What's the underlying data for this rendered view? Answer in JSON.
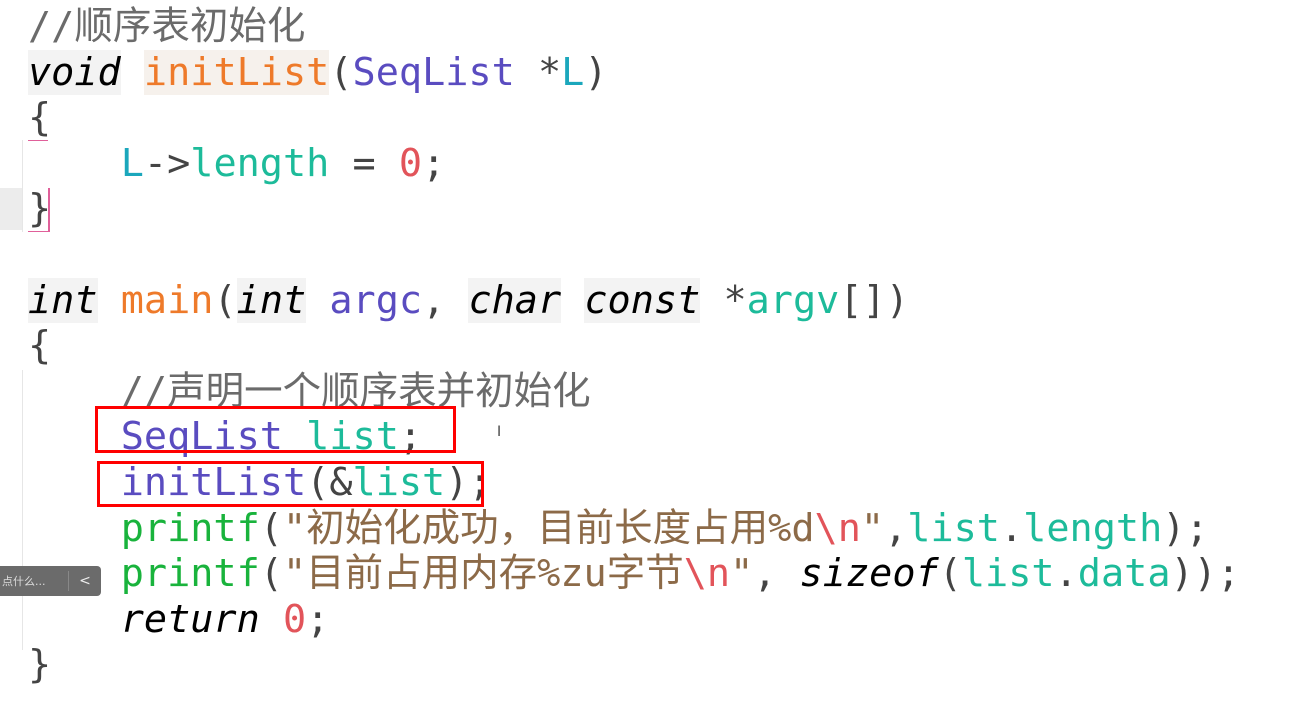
{
  "code_lines": [
    [
      [
        "comment",
        "//顺序表初始化"
      ]
    ],
    [
      [
        "kw",
        "void"
      ],
      [
        "punct",
        " "
      ],
      [
        "fn",
        "initList"
      ],
      [
        "punct",
        "("
      ],
      [
        "type",
        "SeqList"
      ],
      [
        "punct",
        " *"
      ],
      [
        "param",
        "L"
      ],
      [
        "punct",
        ")"
      ]
    ],
    [
      [
        "punct",
        "{"
      ]
    ],
    [
      [
        "punct",
        "    "
      ],
      [
        "param",
        "L"
      ],
      [
        "punct",
        "->"
      ],
      [
        "member",
        "length"
      ],
      [
        "punct",
        " = "
      ],
      [
        "num",
        "0"
      ],
      [
        "punct",
        ";"
      ]
    ],
    [
      [
        "punct",
        "}"
      ]
    ],
    [],
    [
      [
        "kw",
        "int"
      ],
      [
        "punct",
        " "
      ],
      [
        "fnm",
        "main"
      ],
      [
        "punct",
        "("
      ],
      [
        "kw",
        "int"
      ],
      [
        "punct",
        " "
      ],
      [
        "type",
        "argc"
      ],
      [
        "punct",
        ", "
      ],
      [
        "kw",
        "char"
      ],
      [
        "punct",
        " "
      ],
      [
        "kw",
        "const"
      ],
      [
        "punct",
        " *"
      ],
      [
        "member",
        "argv"
      ],
      [
        "punct",
        "[])"
      ]
    ],
    [
      [
        "punct",
        "{"
      ]
    ],
    [
      [
        "punct",
        "    "
      ],
      [
        "comment",
        "//声明一个顺序表并初始化"
      ]
    ],
    [
      [
        "punct",
        "    "
      ],
      [
        "type",
        "SeqList"
      ],
      [
        "punct",
        " "
      ],
      [
        "member",
        "list"
      ],
      [
        "punct",
        ";"
      ]
    ],
    [
      [
        "punct",
        "    "
      ],
      [
        "call2",
        "initList"
      ],
      [
        "punct",
        "(&"
      ],
      [
        "member",
        "list"
      ],
      [
        "punct",
        ");"
      ]
    ],
    [
      [
        "punct",
        "    "
      ],
      [
        "call",
        "printf"
      ],
      [
        "punct",
        "("
      ],
      [
        "str",
        "\"初始化成功，目前长度占用%d"
      ],
      [
        "esc",
        "\\n"
      ],
      [
        "str",
        "\""
      ],
      [
        "punct",
        ","
      ],
      [
        "member",
        "list"
      ],
      [
        "punct",
        "."
      ],
      [
        "member",
        "length"
      ],
      [
        "punct",
        ");"
      ]
    ],
    [
      [
        "punct",
        "    "
      ],
      [
        "call",
        "printf"
      ],
      [
        "punct",
        "("
      ],
      [
        "str",
        "\"目前占用内存%zu字节"
      ],
      [
        "esc",
        "\\n"
      ],
      [
        "str",
        "\""
      ],
      [
        "punct",
        ", "
      ],
      [
        "kwp",
        "sizeof"
      ],
      [
        "punct",
        "("
      ],
      [
        "member",
        "list"
      ],
      [
        "punct",
        "."
      ],
      [
        "member",
        "data"
      ],
      [
        "punct",
        "));"
      ]
    ],
    [
      [
        "punct",
        "    "
      ],
      [
        "kwp",
        "return"
      ],
      [
        "punct",
        " "
      ],
      [
        "num",
        "0"
      ],
      [
        "punct",
        ";"
      ]
    ],
    [
      [
        "punct",
        "}"
      ]
    ]
  ],
  "widget": {
    "label": "点什么...",
    "chevron": "<"
  },
  "colors": {
    "highlight_box": "#ff0000",
    "function": "#ee7a2a",
    "type": "#5a4cc0",
    "member": "#1dbb9a"
  }
}
